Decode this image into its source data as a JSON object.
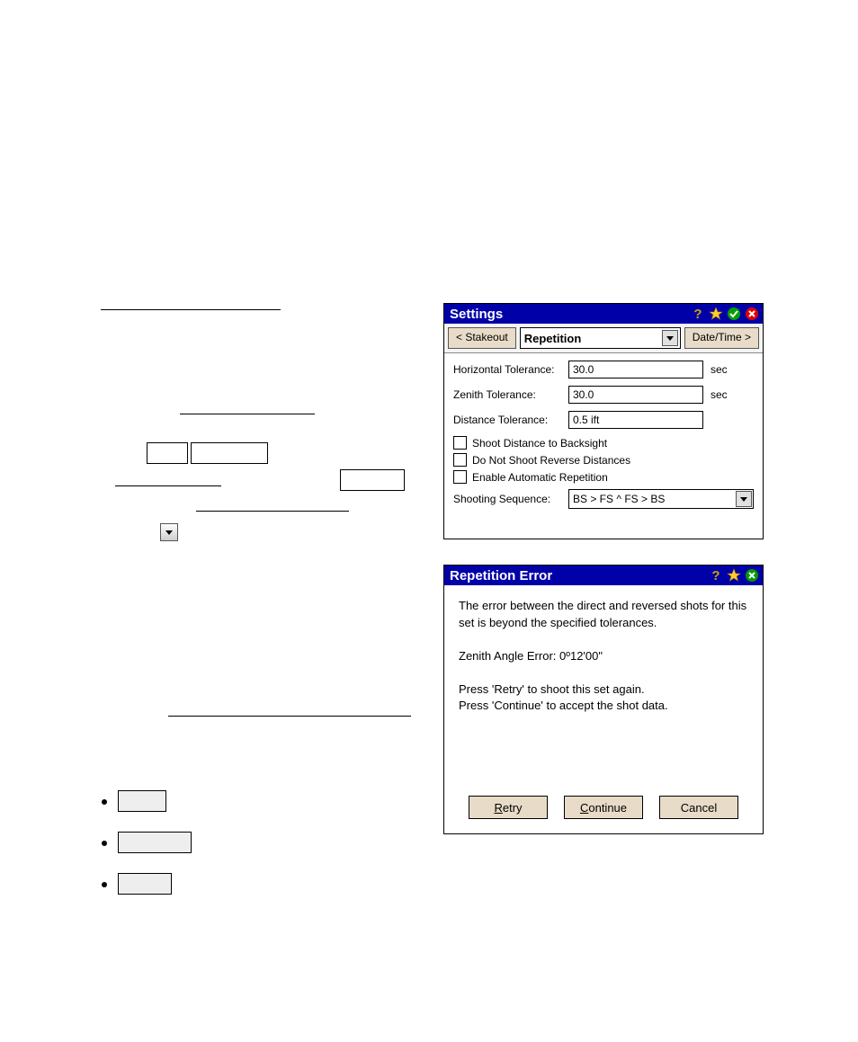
{
  "settings": {
    "title": "Settings",
    "nav": {
      "prev": "< Stakeout",
      "current": "Repetition",
      "next": "Date/Time >"
    },
    "fields": {
      "horiz": {
        "label": "Horizontal Tolerance:",
        "value": "30.0",
        "unit": "sec"
      },
      "zenith": {
        "label": "Zenith Tolerance:",
        "value": "30.0",
        "unit": "sec"
      },
      "dist": {
        "label": "Distance Tolerance:",
        "value": "0.5 ift",
        "unit": ""
      }
    },
    "checkboxes": {
      "backsight": "Shoot Distance to Backsight",
      "noreverse": "Do Not Shoot Reverse Distances",
      "autorep": "Enable Automatic Repetition"
    },
    "sequence": {
      "label": "Shooting Sequence:",
      "value": "BS > FS ^ FS > BS"
    }
  },
  "reperr": {
    "title": "Repetition Error",
    "para1": "The error between the direct and reversed shots for this set is beyond the specified tolerances.",
    "zenith": "Zenith Angle Error:  0º12'00\"",
    "retry_hint": "Press 'Retry' to shoot this set again.",
    "cont_hint": "Press 'Continue' to accept the shot data.",
    "buttons": {
      "retry_pre": "R",
      "retry_rest": "etry",
      "cont_pre": "C",
      "cont_rest": "ontinue",
      "cancel": "Cancel"
    }
  }
}
